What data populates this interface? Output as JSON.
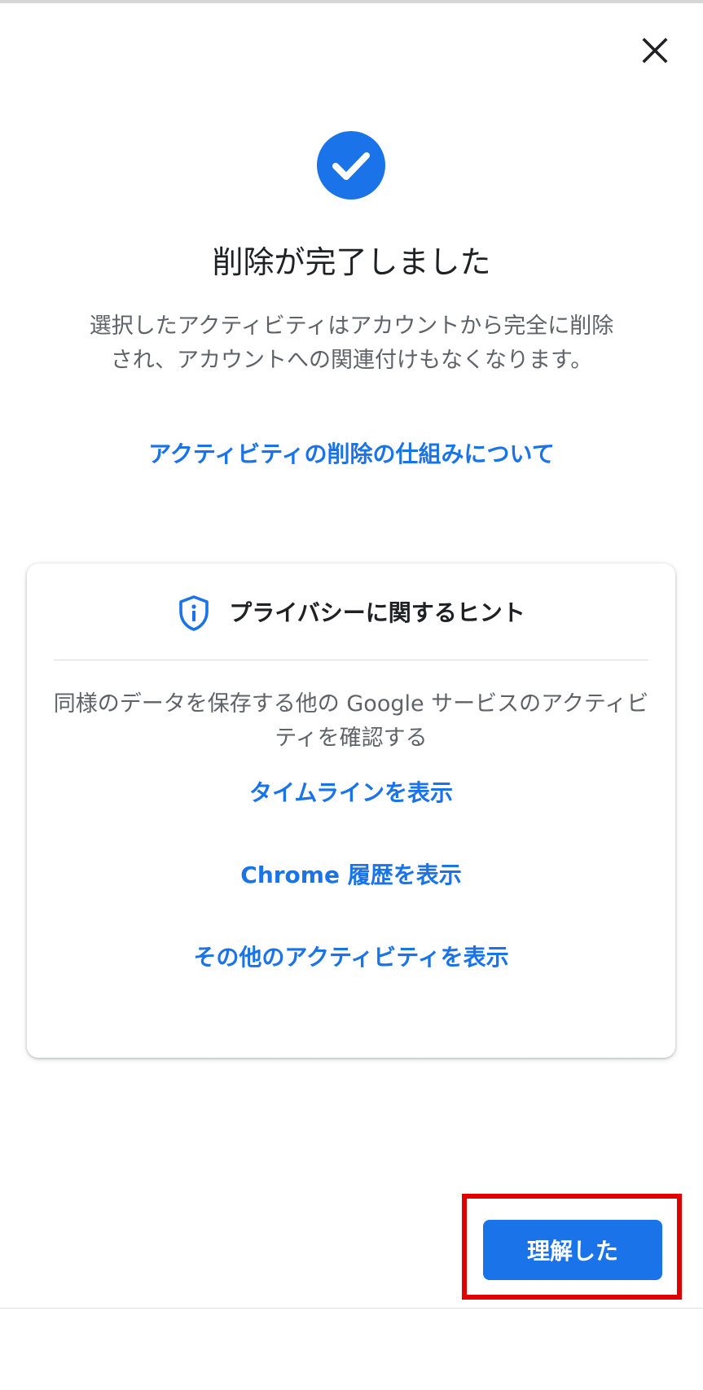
{
  "dialog": {
    "close_icon": "close-icon",
    "success_icon": "check-circle-icon",
    "title": "削除が完了しました",
    "description": "選択したアクティビティはアカウントから完全に削除され、アカウントへの関連付けもなくなります。",
    "learn_more_link": "アクティビティの削除の仕組みについて"
  },
  "privacy_card": {
    "icon": "shield-info-icon",
    "title": "プライバシーに関するヒント",
    "description": "同様のデータを保存する他の Google サービスのアクティビティを確認する",
    "links": [
      "タイムラインを表示",
      "Chrome 履歴を表示",
      "その他のアクティビティを表示"
    ]
  },
  "footer": {
    "confirm_label": "理解した"
  },
  "colors": {
    "accent": "#1a73e8",
    "text_primary": "#202124",
    "text_secondary": "#5f6368",
    "highlight": "#e00000"
  }
}
